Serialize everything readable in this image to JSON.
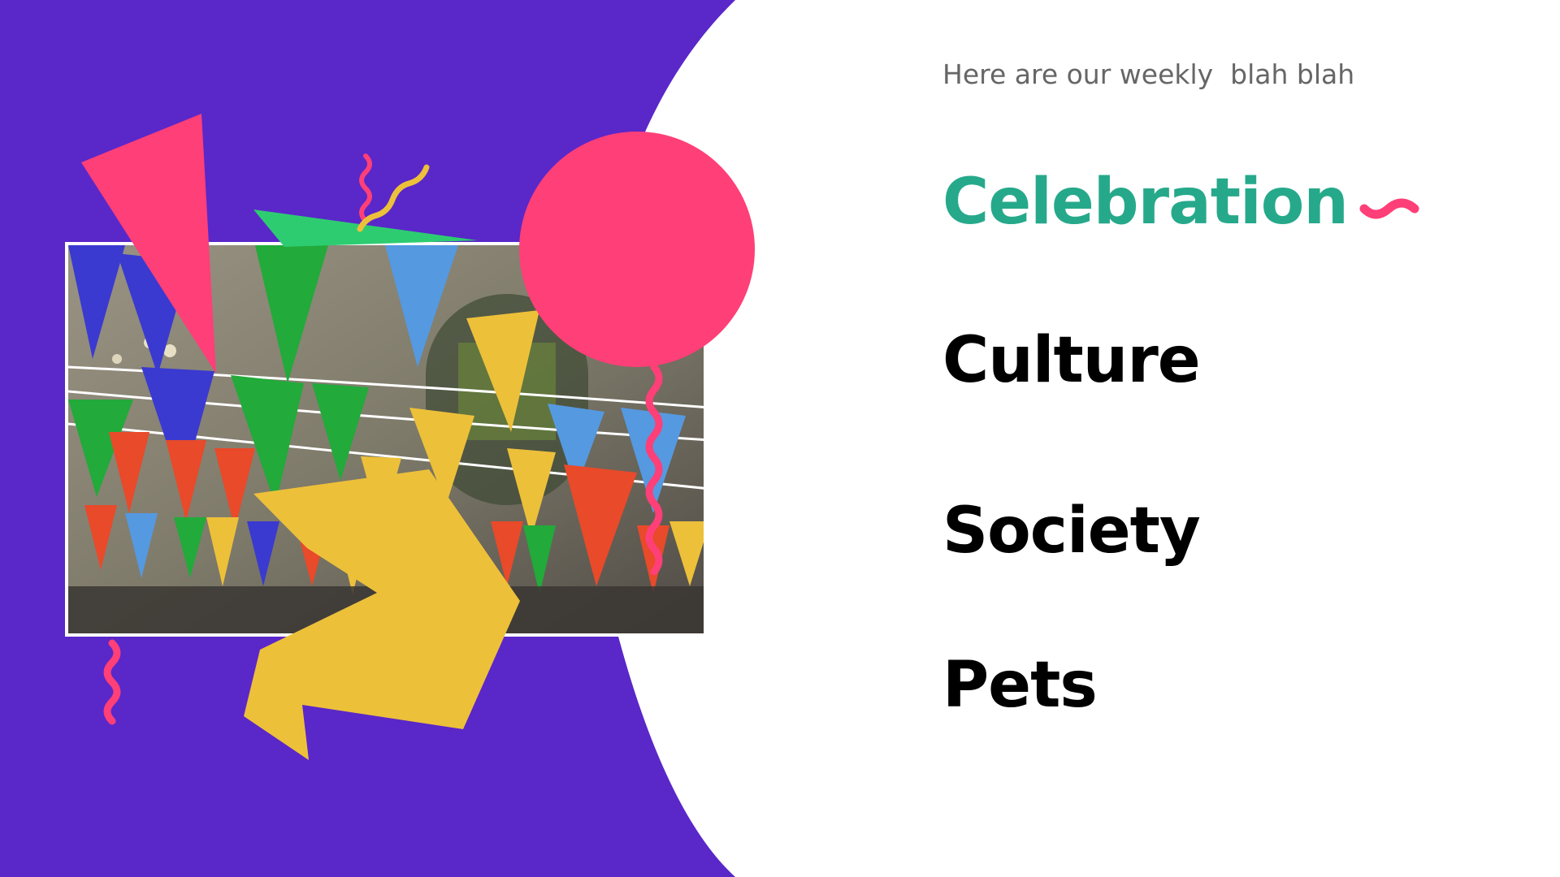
{
  "header": {
    "subtitle": "Here are our weekly  blah blah"
  },
  "menu": {
    "items": [
      {
        "label": "Celebration",
        "active": true
      },
      {
        "label": "Culture",
        "active": false
      },
      {
        "label": "Society",
        "active": false
      },
      {
        "label": "Pets",
        "active": false
      }
    ]
  },
  "colors": {
    "purple": "#5a27c9",
    "pink": "#ff3f77",
    "yellow": "#edc03a",
    "green": "#2ecc71",
    "teal": "#26a98b",
    "text": "#000000",
    "subtitle": "#666666"
  },
  "hero": {
    "image": "bunting-flags-photo"
  }
}
